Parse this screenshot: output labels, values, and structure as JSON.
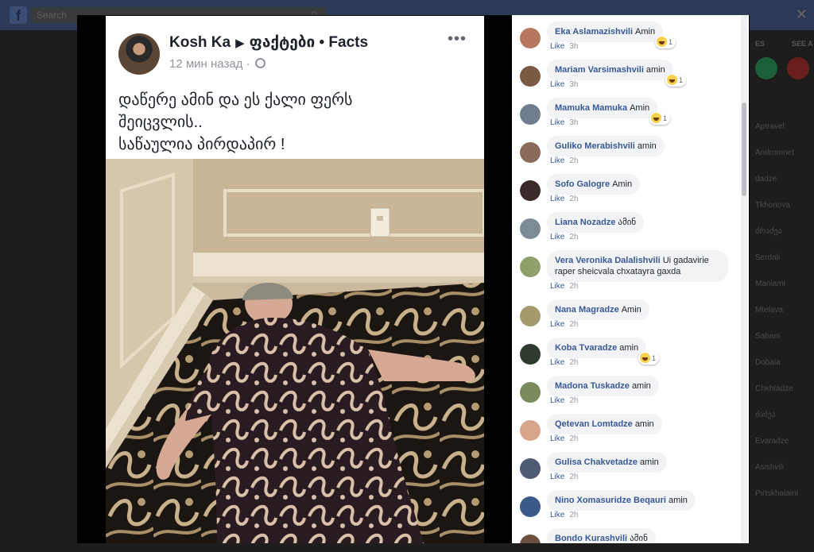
{
  "topbar": {
    "logo": "f",
    "search_placeholder": "Search",
    "search_icon": "search-icon"
  },
  "background_right": {
    "heading_left": "ES",
    "heading_right": "SEE A",
    "names": [
      "Aptravel",
      "Andromnet",
      "dadze",
      "Tkhonova",
      "ძრაძეა",
      "Serdali",
      "Maniami",
      "Mtelava",
      "Sabani",
      "Dobaia",
      "Chkhtadze",
      "ძაძეა",
      "Evaradze",
      "Asishvili",
      "Pirtskhalaini"
    ]
  },
  "post": {
    "author": "Kosh Ka",
    "page": "ფაქტები • Facts",
    "time": "12 мин назад",
    "text_lines": [
      "დაწერე ამინ და ეს ქალი ფერს",
      "შეიცვლის..",
      "საწაულია პირდაპირ !"
    ],
    "more_label": "•••"
  },
  "comments": [
    {
      "name": "Eka Aslamazishvili",
      "text": "Amin",
      "like": "Like",
      "time": "3h",
      "reactions": "1",
      "avatar_color": "#b5785f"
    },
    {
      "name": "Mariam Varsimashvili",
      "text": "amin",
      "like": "Like",
      "time": "3h",
      "reactions": "1",
      "avatar_color": "#7b5a43"
    },
    {
      "name": "Mamuka Mamuka",
      "text": "Amin",
      "like": "Like",
      "time": "3h",
      "reactions": "1",
      "avatar_color": "#6f7d8f"
    },
    {
      "name": "Guliko Merabishvili",
      "text": "amin",
      "like": "Like",
      "time": "2h",
      "reactions": "",
      "avatar_color": "#8a6a5a"
    },
    {
      "name": "Sofo Galogre",
      "text": "Amin",
      "like": "Like",
      "time": "2h",
      "reactions": "",
      "avatar_color": "#3b2a2a"
    },
    {
      "name": "Liana Nozadze",
      "text": "ამინ",
      "like": "Like",
      "time": "2h",
      "reactions": "",
      "avatar_color": "#7d8c94"
    },
    {
      "name": "Vera Veronika Dalalishvili",
      "text": "Ui gadavirie raper sheicvala chxatayra gaxda",
      "like": "Like",
      "time": "2h",
      "reactions": "",
      "avatar_color": "#8fa06a"
    },
    {
      "name": "Nana Magradze",
      "text": "Amin",
      "like": "Like",
      "time": "2h",
      "reactions": "",
      "avatar_color": "#a59a6e"
    },
    {
      "name": "Koba Tvaradze",
      "text": "amin",
      "like": "Like",
      "time": "2h",
      "reactions": "1",
      "avatar_color": "#2f3a2e"
    },
    {
      "name": "Madona Tuskadze",
      "text": "amin",
      "like": "Like",
      "time": "2h",
      "reactions": "",
      "avatar_color": "#7a8a5a"
    },
    {
      "name": "Qetevan Lomtadze",
      "text": "amin",
      "like": "Like",
      "time": "2h",
      "reactions": "",
      "avatar_color": "#d9a58a"
    },
    {
      "name": "Gulisa Chakvetadze",
      "text": "amin",
      "like": "Like",
      "time": "2h",
      "reactions": "",
      "avatar_color": "#4f5a73"
    },
    {
      "name": "Nino Xomasuridze Beqauri",
      "text": "amin",
      "like": "Like",
      "time": "2h",
      "reactions": "",
      "avatar_color": "#3a5b8a"
    },
    {
      "name": "Bondo Kurashvili",
      "text": "ამინ",
      "like": "Like",
      "time": "",
      "reactions": "",
      "avatar_color": "#6b5040"
    }
  ]
}
